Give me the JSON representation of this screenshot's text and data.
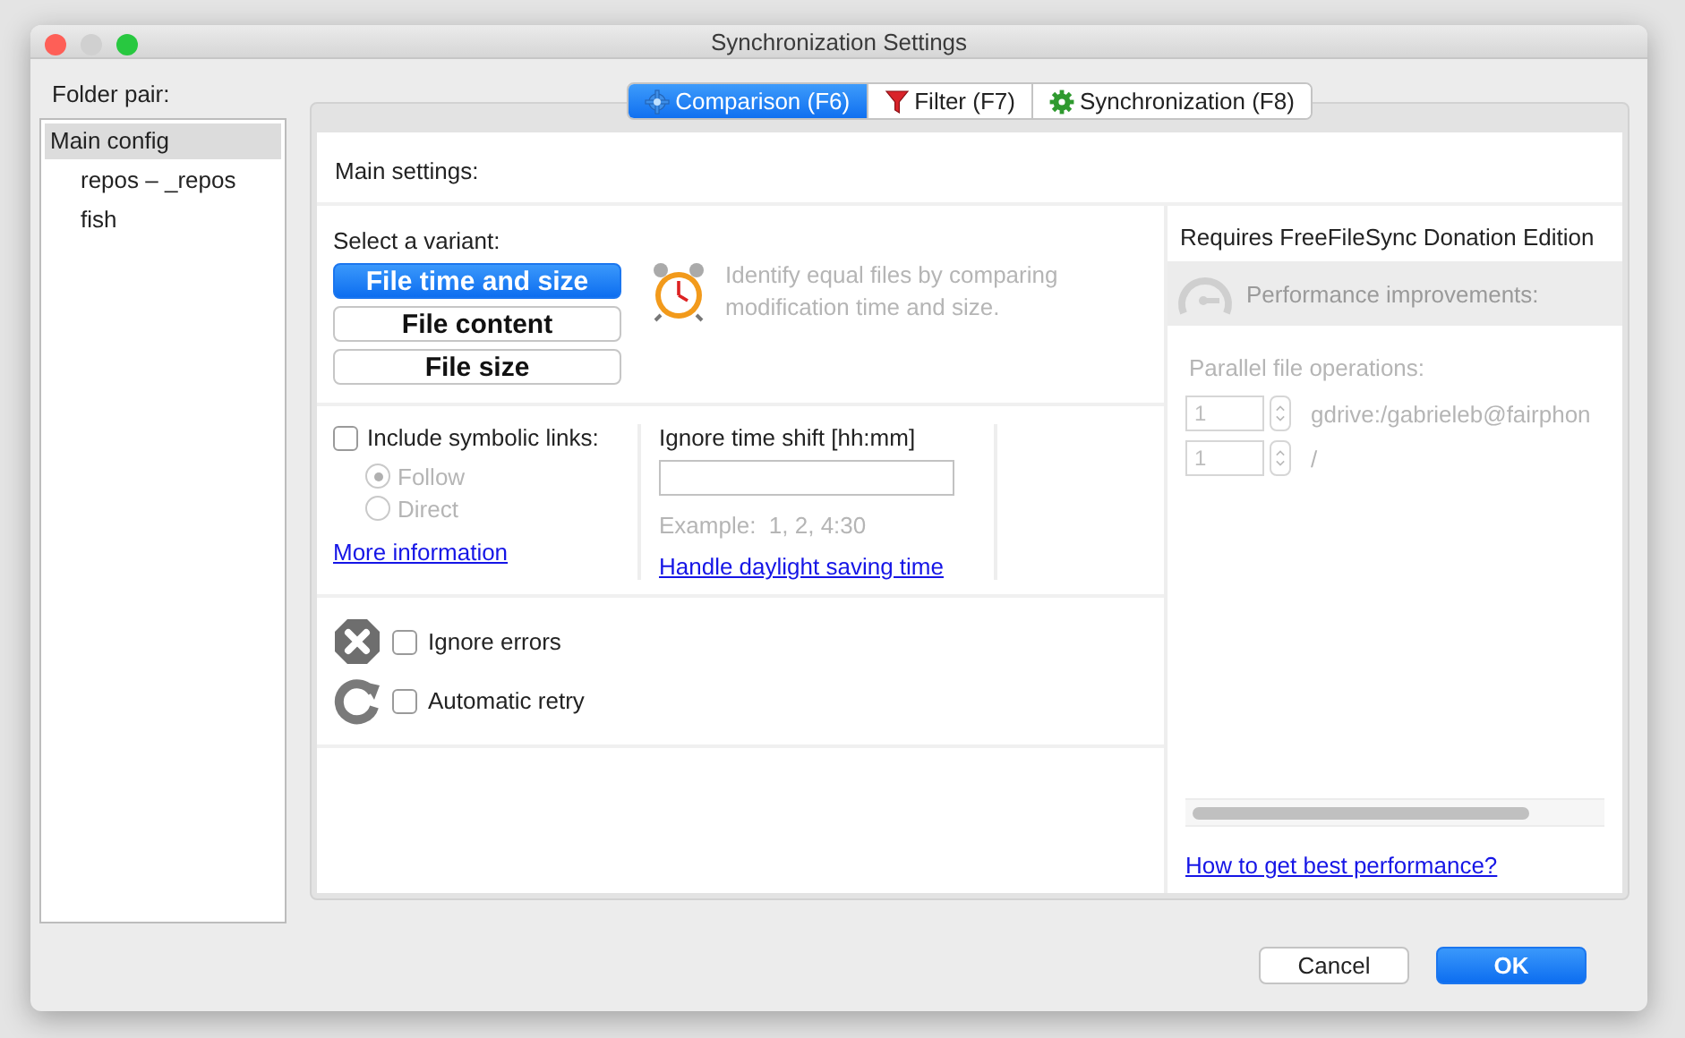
{
  "window": {
    "title": "Synchronization Settings"
  },
  "folder_pair": {
    "label": "Folder pair:",
    "items": [
      {
        "label": "Main config",
        "selected": true,
        "children": [
          {
            "label": "repos – _repos",
            "selected": false
          },
          {
            "label": "fish",
            "selected": false
          }
        ]
      }
    ]
  },
  "tabs": [
    {
      "label": "Comparison (F6)",
      "selected": true
    },
    {
      "label": "Filter (F7)",
      "selected": false
    },
    {
      "label": "Synchronization (F8)",
      "selected": false
    }
  ],
  "main_settings": {
    "label": "Main settings:"
  },
  "variant": {
    "label": "Select a variant:",
    "options": [
      {
        "label": "File time and size",
        "selected": true
      },
      {
        "label": "File content",
        "selected": false
      },
      {
        "label": "File size",
        "selected": false
      }
    ],
    "description": "Identify equal files by comparing modification time and size."
  },
  "symlinks": {
    "label": "Include symbolic links:",
    "checked": false,
    "options": [
      {
        "label": "Follow",
        "selected": true,
        "disabled": true
      },
      {
        "label": "Direct",
        "selected": false,
        "disabled": true
      }
    ],
    "link": "More information"
  },
  "time_shift": {
    "label": "Ignore time shift [hh:mm]",
    "example": "Example:  1, 2, 4:30",
    "link": "Handle daylight saving time"
  },
  "error_options": [
    {
      "kind": "error",
      "label": "Ignore errors",
      "checked": false
    },
    {
      "kind": "retry",
      "label": "Automatic retry",
      "checked": false
    }
  ],
  "donation": {
    "notice": "Requires FreeFileSync Donation Edition",
    "performance": "Performance improvements:",
    "parallel_label": "Parallel file operations:",
    "rows": [
      {
        "value": "1",
        "target": "gdrive:/gabrieleb@fairphon"
      },
      {
        "value": "1",
        "target": "/"
      }
    ],
    "link": "How to get best performance?"
  },
  "buttons": [
    {
      "label": "Cancel",
      "kind": "normal"
    },
    {
      "label": "OK",
      "kind": "default"
    }
  ]
}
